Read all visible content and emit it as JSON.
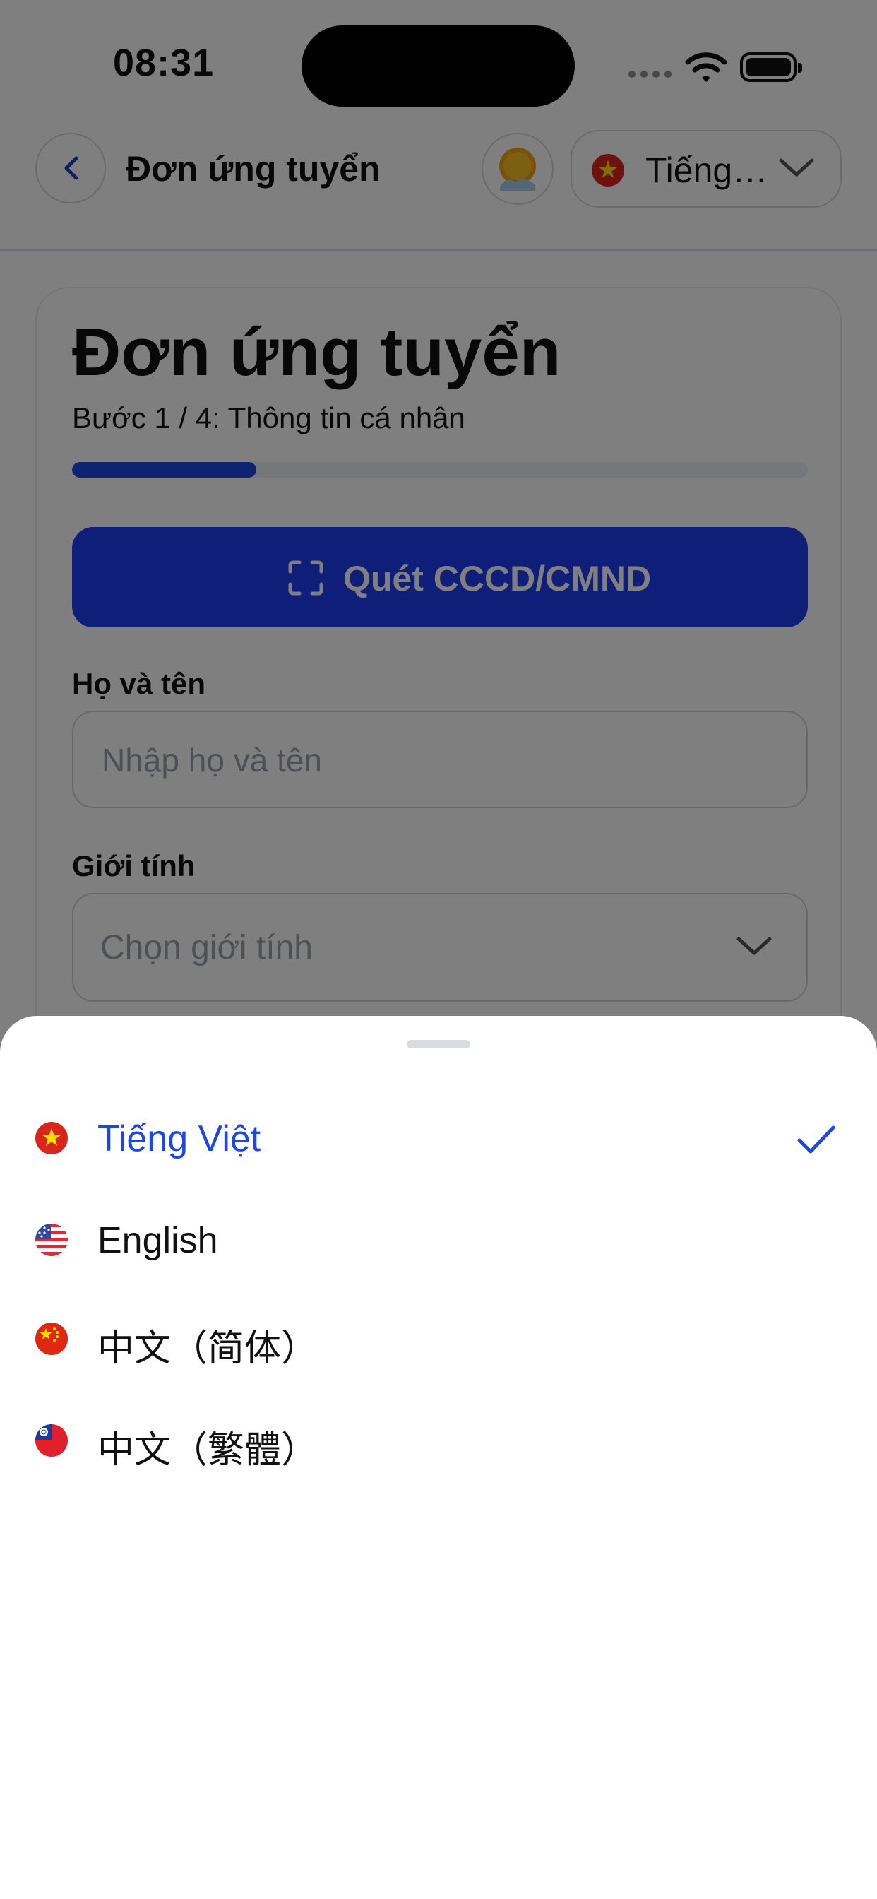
{
  "status_bar": {
    "time": "08:31",
    "icons": [
      "signal-icon",
      "wifi-icon",
      "battery-icon"
    ]
  },
  "header": {
    "back_icon": "chevron-left-icon",
    "title": "Đơn ứng tuyển",
    "avatar_icon": "avatar-sun-icon",
    "language_selector": {
      "flag_icon": "vietnam-flag-icon",
      "label": "Tiếng Việt",
      "chevron_icon": "chevron-down-icon"
    }
  },
  "form": {
    "title": "Đơn ứng tuyển",
    "step_label": "Bước 1 / 4: Thông tin cá nhân",
    "progress": 0.25,
    "scan_button": {
      "icon": "scan-frame-icon",
      "label": "Quét CCCD/CMND"
    },
    "full_name": {
      "label": "Họ và tên",
      "value": "",
      "placeholder": "Nhập họ và tên"
    },
    "gender": {
      "label": "Giới tính",
      "value": "Chọn giới tính",
      "chevron_icon": "chevron-down-icon"
    }
  },
  "language_sheet": {
    "selected_index": 0,
    "check_icon": "checkmark-icon",
    "options": [
      {
        "label": "Tiếng Việt",
        "flag_icon": "vietnam-flag-icon"
      },
      {
        "label": "English",
        "flag_icon": "us-flag-icon"
      },
      {
        "label": "中文（简体）",
        "flag_icon": "china-flag-icon"
      },
      {
        "label": "中文（繁體）",
        "flag_icon": "taiwan-flag-icon"
      }
    ]
  },
  "colors": {
    "accent": "#1e46e6",
    "scan_button": "#1e3df0",
    "overlay": "rgba(0,0,0,0.5)",
    "placeholder_text": "#9aa0a8"
  }
}
